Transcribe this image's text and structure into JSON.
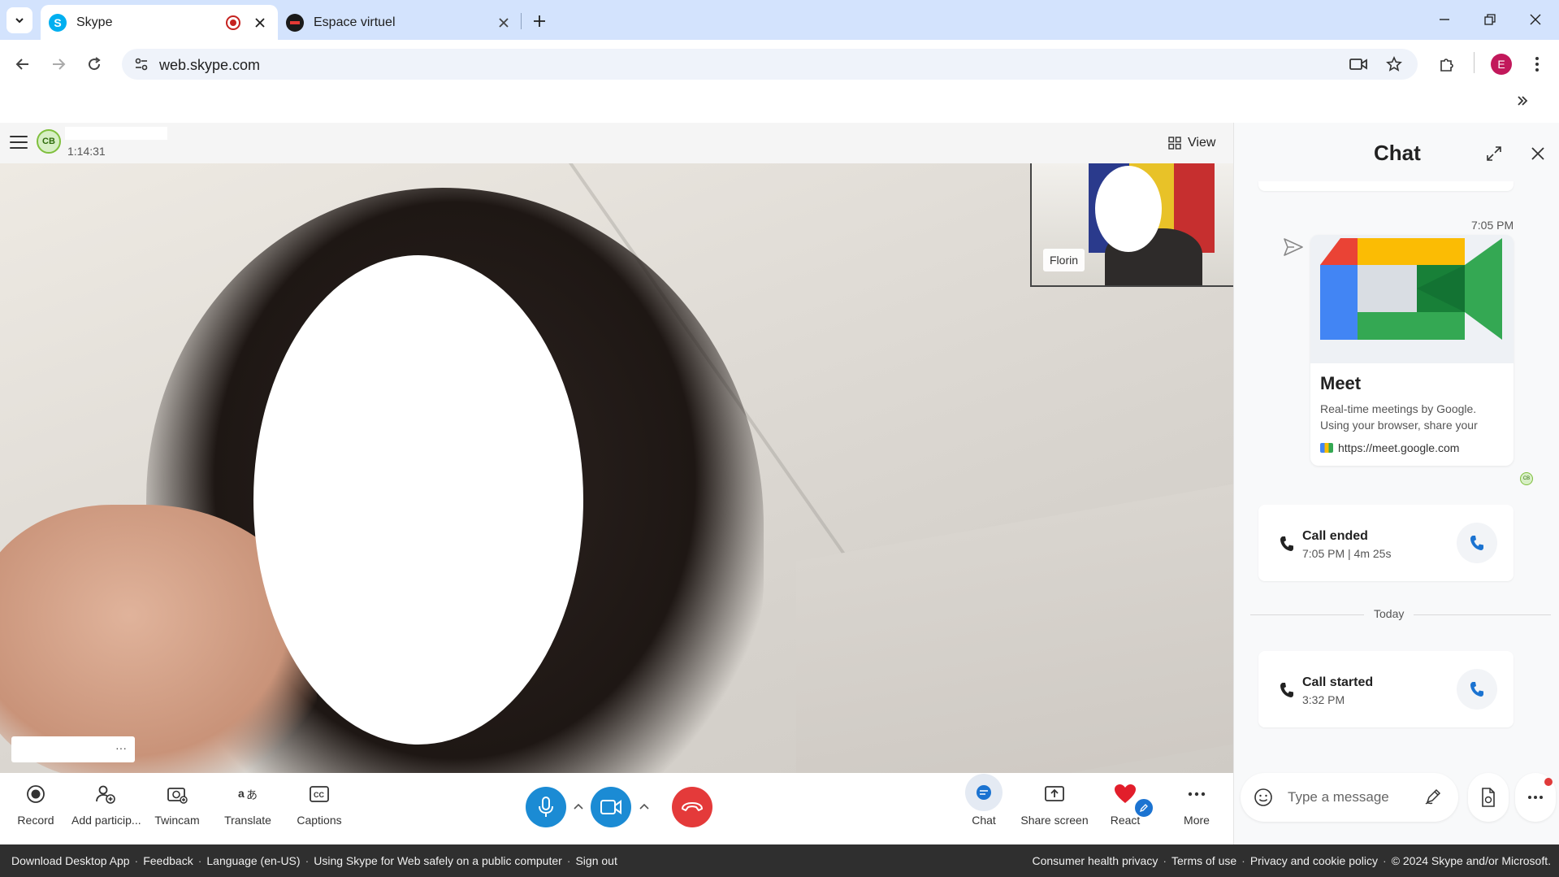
{
  "browser": {
    "tabs": [
      {
        "title": "Skype",
        "active": true,
        "recording": true
      },
      {
        "title": "Espace virtuel",
        "active": false
      }
    ],
    "url": "web.skype.com",
    "profile_initial": "E"
  },
  "call": {
    "initials": "CB",
    "timer": "1:14:31",
    "view_label": "View",
    "remote_participant": "Florin",
    "self_menu": "···"
  },
  "controls": {
    "left": [
      {
        "label": "Record",
        "icon": "record-icon"
      },
      {
        "label": "Add particip...",
        "icon": "add-participant-icon"
      },
      {
        "label": "Twincam",
        "icon": "twincam-icon"
      },
      {
        "label": "Translate",
        "icon": "translate-icon"
      },
      {
        "label": "Captions",
        "icon": "captions-icon"
      }
    ],
    "right": [
      {
        "label": "Chat",
        "icon": "chat-icon"
      },
      {
        "label": "Share screen",
        "icon": "share-screen-icon"
      },
      {
        "label": "React",
        "icon": "heart-icon"
      },
      {
        "label": "More",
        "icon": "more-icon"
      }
    ],
    "colors": {
      "mic": "#1b8bd4",
      "camera": "#1b8bd4",
      "hangup": "#e43a3a"
    }
  },
  "chat": {
    "title": "Chat",
    "message_time": "7:05 PM",
    "link_preview": {
      "title": "Meet",
      "description": "Real-time meetings by Google. Using your browser, share your",
      "url": "https://meet.google.com"
    },
    "seen_by": "CB",
    "call_ended": {
      "title": "Call ended",
      "detail": "7:05 PM | 4m 25s"
    },
    "divider": "Today",
    "call_started": {
      "title": "Call started",
      "detail": "3:32 PM"
    },
    "composer_placeholder": "Type a message"
  },
  "footer": {
    "left": [
      "Download Desktop App",
      "Feedback",
      "Language (en-US)",
      "Using Skype for Web safely on a public computer",
      "Sign out"
    ],
    "right": [
      "Consumer health privacy",
      "Terms of use",
      "Privacy and cookie policy",
      "© 2024 Skype and/or Microsoft."
    ]
  }
}
